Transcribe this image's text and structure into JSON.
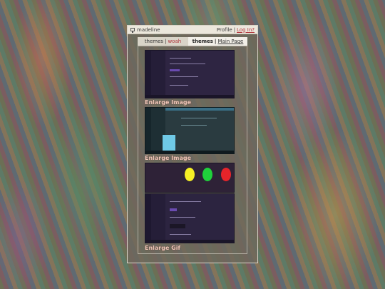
{
  "titlebar": {
    "username": "madeline",
    "profile_label": "Profile",
    "separator": "|",
    "login_label": "Log In?"
  },
  "tabs": {
    "left": {
      "label": "themes",
      "separator": "|",
      "accent": "woah"
    },
    "right": {
      "label": "themes",
      "separator": "|",
      "link": "Main Page"
    }
  },
  "gallery": {
    "captions": [
      "Enlarge Image",
      "Enlarge Image",
      "Enlarge Gif"
    ]
  },
  "icons": {
    "user": "monitor-icon"
  },
  "colors": {
    "accent": "#b0343a",
    "dot_yellow": "#f5ef25",
    "dot_green": "#1fd23b",
    "dot_red": "#e6242a"
  }
}
